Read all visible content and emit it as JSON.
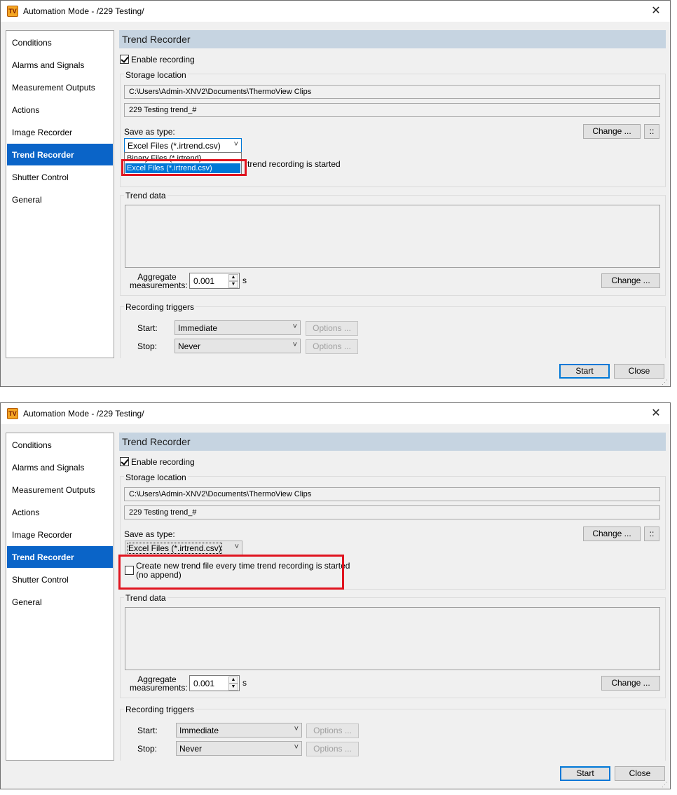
{
  "window": {
    "title": "Automation Mode - /229 Testing/",
    "app_icon_text": "TV",
    "close_glyph": "✕"
  },
  "sidebar": {
    "items": [
      "Conditions",
      "Alarms and Signals",
      "Measurement Outputs",
      "Actions",
      "Image Recorder",
      "Trend Recorder",
      "Shutter Control",
      "General"
    ],
    "active": "Trend Recorder"
  },
  "panel": {
    "header": "Trend Recorder",
    "enable_recording_label": "Enable recording",
    "enable_recording_checked": true,
    "storage_location_label": "Storage location",
    "path": "C:\\Users\\Admin-XNV2\\Documents\\ThermoView Clips",
    "filename": "229 Testing trend_#",
    "save_as_type_label": "Save as type:",
    "save_as_type_value": "Excel Files (*.irtrend.csv)",
    "save_as_type_options": [
      "Binary Files (*.irtrend)",
      "Excel Files (*.irtrend.csv)"
    ],
    "change_label": "Change ...",
    "dots_label": "::",
    "new_file_label_line1": "Create new trend file every time trend recording is started",
    "new_file_label_line2": "(no append)",
    "new_file_label_partial": "trend recording is started",
    "new_file_checked": false,
    "trend_data_label": "Trend data",
    "aggregate_label_line1": "Aggregate",
    "aggregate_label_line2": "measurements:",
    "aggregate_value": "0.001",
    "aggregate_unit": "s",
    "recording_triggers_label": "Recording triggers",
    "start_label": "Start:",
    "start_value": "Immediate",
    "stop_label": "Stop:",
    "stop_value": "Never",
    "options_label": "Options ..."
  },
  "footer": {
    "start_button": "Start",
    "close_button": "Close"
  },
  "icons": {
    "dropdown_arrow": "˅",
    "spin_up": "▲",
    "spin_down": "▼",
    "grip": "⋰"
  },
  "colors": {
    "accent": "#0a64c8",
    "highlight": "#e0141f",
    "header_bg": "#c6d4e1"
  }
}
